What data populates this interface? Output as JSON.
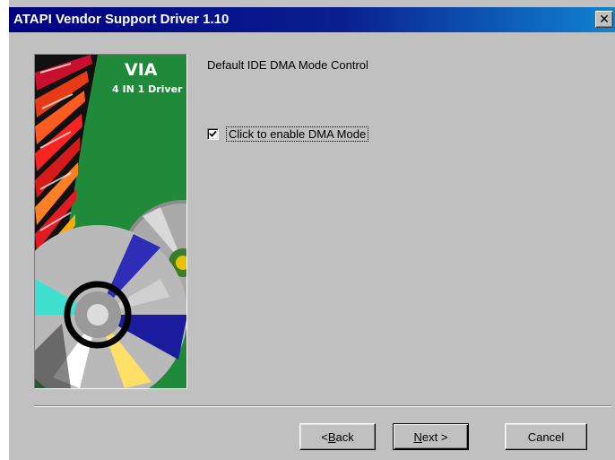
{
  "window": {
    "title": "ATAPI Vendor Support Driver 1.10",
    "close_glyph": "✕"
  },
  "banner": {
    "brand": "VIA",
    "subtitle": "4 IN 1 Driver",
    "icon": "cd-disc-artwork"
  },
  "main": {
    "heading": "Default IDE DMA Mode Control",
    "dma_checkbox": {
      "label": "Click to enable DMA Mode",
      "checked": true
    }
  },
  "buttons": {
    "back": {
      "prefix": "< ",
      "mnemonic": "B",
      "rest": "ack"
    },
    "next": {
      "mnemonic": "N",
      "rest": "ext >"
    },
    "cancel": "Cancel"
  },
  "colors": {
    "titlebar_start": "#000080",
    "titlebar_end": "#1084d0",
    "dialog_face": "#c0c0c0"
  }
}
